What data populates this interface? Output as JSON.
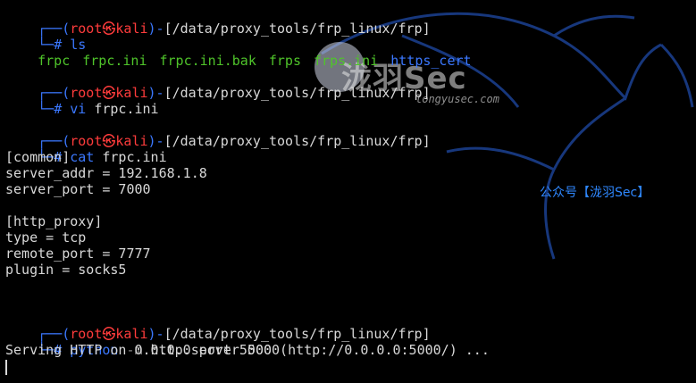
{
  "prompt": {
    "open": "(",
    "user": "root",
    "skull": "㉿",
    "host": "kali",
    "close": ")",
    "dash": "-",
    "hash": "#"
  },
  "blocks": [
    {
      "path": "[/data/proxy_tools/frp_linux/frp]",
      "cmd": "ls",
      "args": ""
    },
    {
      "path": "[/data/proxy_tools/frp_linux/frp]",
      "cmd": "vi",
      "args": " frpc.ini"
    },
    {
      "path": "[/data/proxy_tools/frp_linux/frp]",
      "cmd": "cat",
      "args": " frpc.ini"
    },
    {
      "path": "[/data/proxy_tools/frp_linux/frp]",
      "cmd": "python",
      "flag": " -m",
      "args": " http.server 5000"
    }
  ],
  "ls_output": [
    "frpc",
    "frpc.ini",
    "frpc.ini.bak",
    "frps",
    "frps.ini",
    "https_cert"
  ],
  "ls_colors": {
    "file": "#4fc42a",
    "dir": "#3b78ff"
  },
  "cat_output": [
    "[common]",
    "server_addr = 192.168.1.8",
    "server_port = 7000",
    "",
    "[http_proxy]",
    "type = tcp",
    "remote_port = 7777",
    "plugin = socks5"
  ],
  "server_output": "Serving HTTP on 0.0.0.0 port 5000 (http://0.0.0.0:5000/) ...",
  "watermark": {
    "title": "泷羽Sec",
    "url": "longyusec.com",
    "public_account": "公众号【泷羽Sec】"
  }
}
